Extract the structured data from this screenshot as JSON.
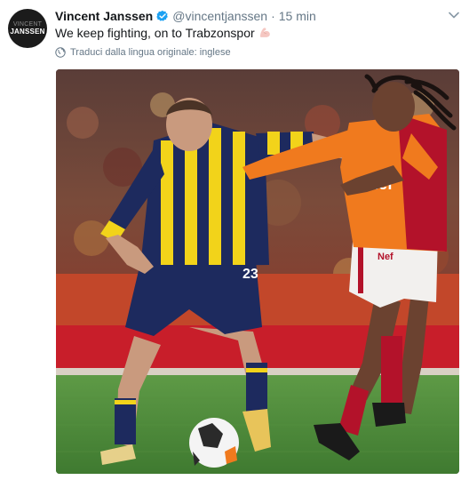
{
  "tweet": {
    "author_name": "Vincent Janssen",
    "handle": "@vincentjanssen",
    "separator": "·",
    "time": "15 min",
    "text": "We keep fighting, on to Trabzonspor",
    "emoji": "flexed-biceps",
    "translate_label": "Traduci dalla lingua originale: inglese",
    "avatar_text_top": "VINCENT",
    "avatar_text_main": "JANSSEN"
  },
  "photo": {
    "description_icon": "football-match-photo",
    "player_left_number": "23",
    "player_right_sponsor": "Nef"
  },
  "colors": {
    "verified_blue": "#1da1f2",
    "text_primary": "#14171a",
    "text_secondary": "#657786",
    "pitch_green": "#4f8a3c",
    "fenerbahce_navy": "#1d2a5e",
    "fenerbahce_yellow": "#f2d31a",
    "galatasaray_orange": "#f07a1e",
    "galatasaray_red": "#b3122a"
  }
}
